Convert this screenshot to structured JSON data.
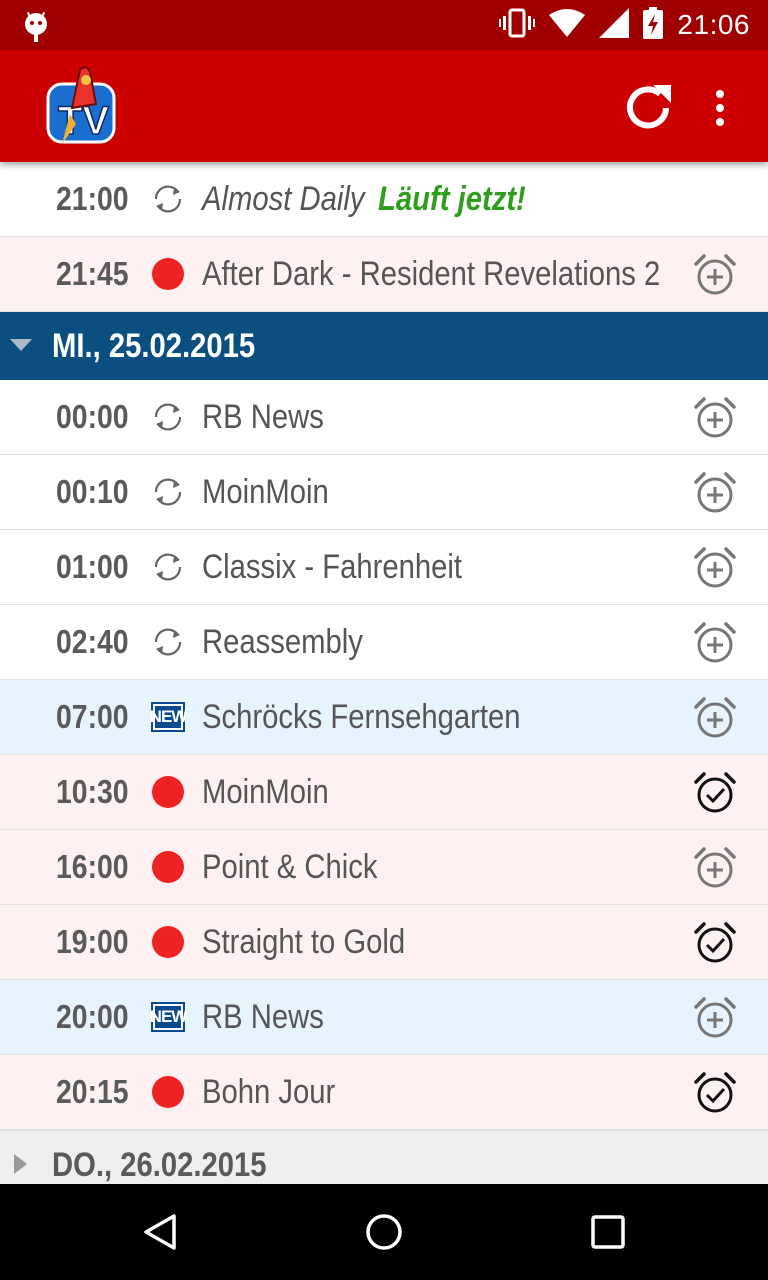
{
  "status_bar": {
    "time": "21:06",
    "icons": [
      "android-icon",
      "vibrate-icon",
      "wifi-icon",
      "signal-icon",
      "battery-charging-icon"
    ]
  },
  "app_bar": {
    "logo": "rocket-beans-tv-logo",
    "actions": [
      "refresh-icon",
      "overflow-menu-icon"
    ]
  },
  "colors": {
    "status_bar": "#a00000",
    "app_bar": "#cc0000",
    "day_header": "#0b4f80",
    "live_text": "#2f9e1e",
    "live_dot": "#ee2222",
    "new_badge": "#0b4a8f",
    "row_pink": "#fdf1f1",
    "row_blue": "#e7f3fd"
  },
  "schedule": {
    "prev_rows": [
      {
        "time": "21:00",
        "type": "rerun",
        "title": "Almost Daily",
        "live_label": "Läuft jetzt!",
        "alarm": "none"
      },
      {
        "time": "21:45",
        "type": "live",
        "title": "After Dark - Resident Revelations 2",
        "alarm": "add"
      }
    ],
    "day1": {
      "label": "MI., 25.02.2015",
      "expanded": true,
      "rows": [
        {
          "time": "00:00",
          "type": "rerun",
          "title": "RB News",
          "alarm": "add"
        },
        {
          "time": "00:10",
          "type": "rerun",
          "title": "MoinMoin",
          "alarm": "add"
        },
        {
          "time": "01:00",
          "type": "rerun",
          "title": "Classix - Fahrenheit",
          "alarm": "add"
        },
        {
          "time": "02:40",
          "type": "rerun",
          "title": "Reassembly",
          "alarm": "add"
        },
        {
          "time": "07:00",
          "type": "new",
          "title": "Schröcks Fernsehgarten",
          "alarm": "add"
        },
        {
          "time": "10:30",
          "type": "live",
          "title": "MoinMoin",
          "alarm": "set"
        },
        {
          "time": "16:00",
          "type": "live",
          "title": "Point & Chick",
          "alarm": "add"
        },
        {
          "time": "19:00",
          "type": "live",
          "title": "Straight to Gold",
          "alarm": "set"
        },
        {
          "time": "20:00",
          "type": "new",
          "title": "RB News",
          "alarm": "add"
        },
        {
          "time": "20:15",
          "type": "live",
          "title": "Bohn Jour",
          "alarm": "set"
        }
      ]
    },
    "day2": {
      "label": "DO., 26.02.2015",
      "expanded": false
    },
    "new_badge_text": "NEW"
  },
  "nav_bar": {
    "buttons": [
      "back-icon",
      "home-icon",
      "recents-icon"
    ]
  }
}
